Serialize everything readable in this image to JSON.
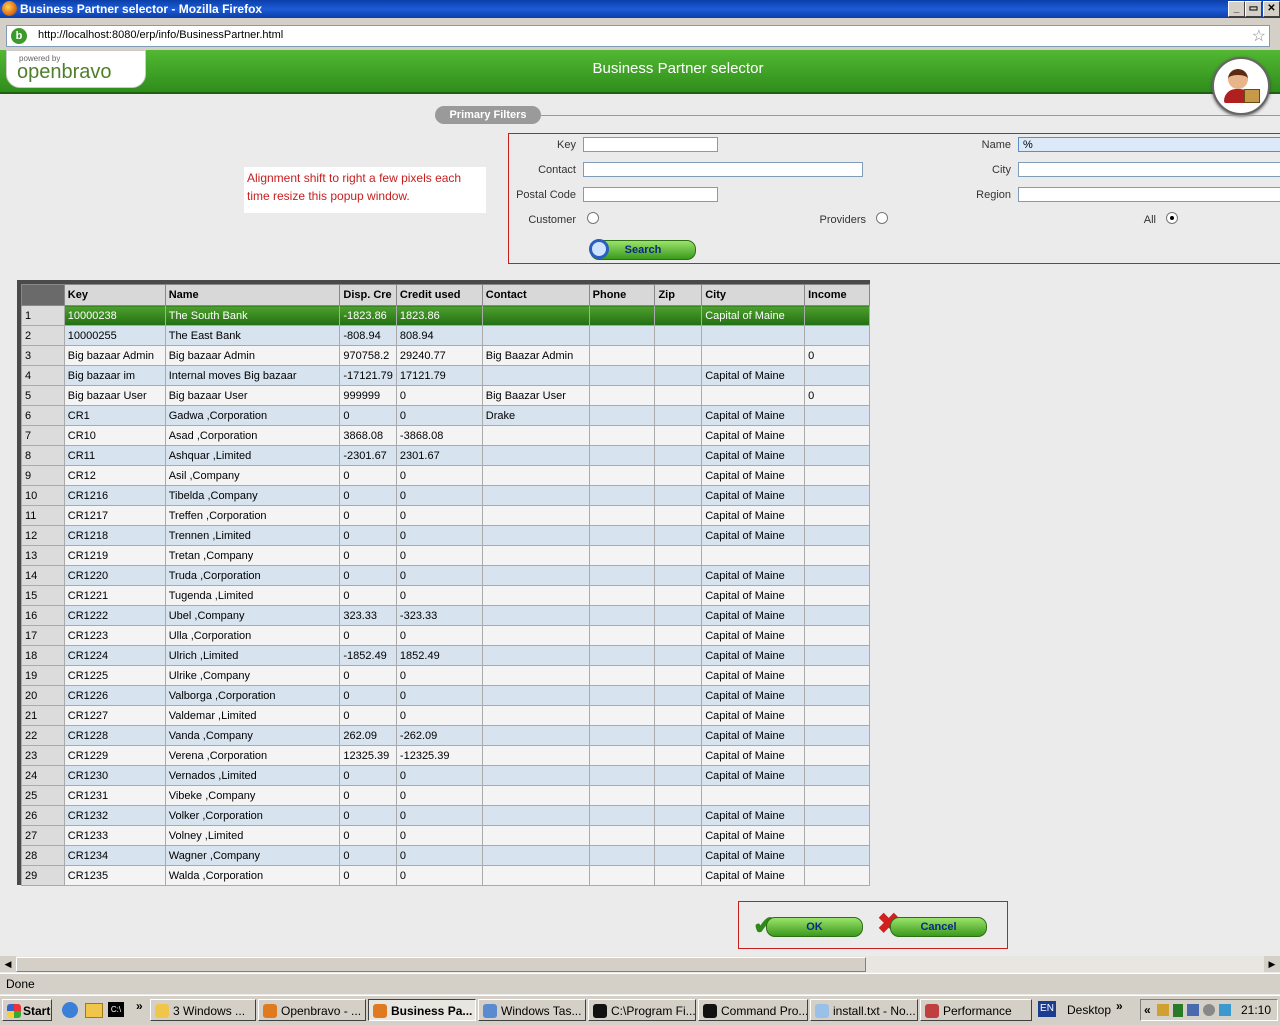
{
  "window": {
    "title": "Business Partner selector - Mozilla Firefox"
  },
  "browser": {
    "url": "http://localhost:8080/erp/info/BusinessPartner.html",
    "status": "Done"
  },
  "header": {
    "logo_small": "powered by",
    "logo_brand": "openbravo",
    "title": "Business Partner selector"
  },
  "filters": {
    "tab_label": "Primary Filters",
    "key_label": "Key",
    "key_value": "",
    "name_label": "Name",
    "name_value": "%",
    "contact_label": "Contact",
    "contact_value": "",
    "city_label": "City",
    "city_value": "",
    "postal_label": "Postal Code",
    "postal_value": "",
    "region_label": "Region",
    "region_value": "",
    "customer_label": "Customer",
    "providers_label": "Providers",
    "all_label": "All",
    "selected_type": "All",
    "search_label": "Search"
  },
  "note": "Alignment shift to right a few pixels each time resize this popup window.",
  "grid": {
    "columns": [
      "Key",
      "Name",
      "Disp. Cre",
      "Credit used",
      "Contact",
      "Phone",
      "Zip",
      "City",
      "Income"
    ],
    "selected_row": 1,
    "rows": [
      [
        "10000238",
        "The South Bank",
        "-1823.86",
        "1823.86",
        "",
        "",
        "",
        "Capital of Maine",
        ""
      ],
      [
        "10000255",
        "The East Bank",
        "-808.94",
        "808.94",
        "",
        "",
        "",
        "",
        ""
      ],
      [
        "Big bazaar Admin",
        "Big bazaar Admin",
        "970758.2",
        "29240.77",
        "Big Baazar Admin",
        "",
        "",
        "",
        "0"
      ],
      [
        "Big bazaar im",
        "Internal moves Big bazaar",
        "-17121.79",
        "17121.79",
        "",
        "",
        "",
        "Capital of Maine",
        ""
      ],
      [
        "Big bazaar User",
        "Big bazaar User",
        "999999",
        "0",
        "Big Baazar User",
        "",
        "",
        "",
        "0"
      ],
      [
        "CR1",
        "Gadwa ,Corporation",
        "0",
        "0",
        "Drake",
        "",
        "",
        "Capital of Maine",
        ""
      ],
      [
        "CR10",
        "Asad ,Corporation",
        "3868.08",
        "-3868.08",
        "",
        "",
        "",
        "Capital of Maine",
        ""
      ],
      [
        "CR11",
        "Ashquar ,Limited",
        "-2301.67",
        "2301.67",
        "",
        "",
        "",
        "Capital of Maine",
        ""
      ],
      [
        "CR12",
        "Asil ,Company",
        "0",
        "0",
        "",
        "",
        "",
        "Capital of Maine",
        ""
      ],
      [
        "CR1216",
        "Tibelda ,Company",
        "0",
        "0",
        "",
        "",
        "",
        "Capital of Maine",
        ""
      ],
      [
        "CR1217",
        "Treffen ,Corporation",
        "0",
        "0",
        "",
        "",
        "",
        "Capital of Maine",
        ""
      ],
      [
        "CR1218",
        "Trennen ,Limited",
        "0",
        "0",
        "",
        "",
        "",
        "Capital of Maine",
        ""
      ],
      [
        "CR1219",
        "Tretan ,Company",
        "0",
        "0",
        "",
        "",
        "",
        "",
        ""
      ],
      [
        "CR1220",
        "Truda ,Corporation",
        "0",
        "0",
        "",
        "",
        "",
        "Capital of Maine",
        ""
      ],
      [
        "CR1221",
        "Tugenda ,Limited",
        "0",
        "0",
        "",
        "",
        "",
        "Capital of Maine",
        ""
      ],
      [
        "CR1222",
        "Ubel ,Company",
        "323.33",
        "-323.33",
        "",
        "",
        "",
        "Capital of Maine",
        ""
      ],
      [
        "CR1223",
        "Ulla ,Corporation",
        "0",
        "0",
        "",
        "",
        "",
        "Capital of Maine",
        ""
      ],
      [
        "CR1224",
        "Ulrich ,Limited",
        "-1852.49",
        "1852.49",
        "",
        "",
        "",
        "Capital of Maine",
        ""
      ],
      [
        "CR1225",
        "Ulrike ,Company",
        "0",
        "0",
        "",
        "",
        "",
        "Capital of Maine",
        ""
      ],
      [
        "CR1226",
        "Valborga ,Corporation",
        "0",
        "0",
        "",
        "",
        "",
        "Capital of Maine",
        ""
      ],
      [
        "CR1227",
        "Valdemar ,Limited",
        "0",
        "0",
        "",
        "",
        "",
        "Capital of Maine",
        ""
      ],
      [
        "CR1228",
        "Vanda ,Company",
        "262.09",
        "-262.09",
        "",
        "",
        "",
        "Capital of Maine",
        ""
      ],
      [
        "CR1229",
        "Verena ,Corporation",
        "12325.39",
        "-12325.39",
        "",
        "",
        "",
        "Capital of Maine",
        ""
      ],
      [
        "CR1230",
        "Vernados ,Limited",
        "0",
        "0",
        "",
        "",
        "",
        "Capital of Maine",
        ""
      ],
      [
        "CR1231",
        "Vibeke ,Company",
        "0",
        "0",
        "",
        "",
        "",
        "",
        ""
      ],
      [
        "CR1232",
        "Volker ,Corporation",
        "0",
        "0",
        "",
        "",
        "",
        "Capital of Maine",
        ""
      ],
      [
        "CR1233",
        "Volney ,Limited",
        "0",
        "0",
        "",
        "",
        "",
        "Capital of Maine",
        ""
      ],
      [
        "CR1234",
        "Wagner ,Company",
        "0",
        "0",
        "",
        "",
        "",
        "Capital of Maine",
        ""
      ],
      [
        "CR1235",
        "Walda ,Corporation",
        "0",
        "0",
        "",
        "",
        "",
        "Capital of Maine",
        ""
      ]
    ]
  },
  "actions": {
    "ok_label": "OK",
    "cancel_label": "Cancel"
  },
  "taskbar": {
    "start_label": "Start",
    "chevron": "»",
    "buttons": [
      {
        "label": "3 Windows ...",
        "icon": "folder-icon"
      },
      {
        "label": "Openbravo - ...",
        "icon": "firefox-icon"
      },
      {
        "label": "Business Pa...",
        "icon": "firefox-icon",
        "active": true
      },
      {
        "label": "Windows Tas...",
        "icon": "task-manager-icon"
      },
      {
        "label": "C:\\Program Fi...",
        "icon": "console-icon"
      },
      {
        "label": "Command Pro...",
        "icon": "console-icon"
      },
      {
        "label": "install.txt - No...",
        "icon": "notepad-icon"
      },
      {
        "label": "Performance",
        "icon": "performance-icon"
      }
    ],
    "lang": "EN",
    "desktop_label": "Desktop",
    "tray_chevron": "«",
    "clock": "21:10"
  },
  "colors": {
    "header_green": "#3a9a22",
    "selected_row": "#2f8a1c",
    "alt_row": "#d7e3ef",
    "error_red": "#c81e1e"
  }
}
